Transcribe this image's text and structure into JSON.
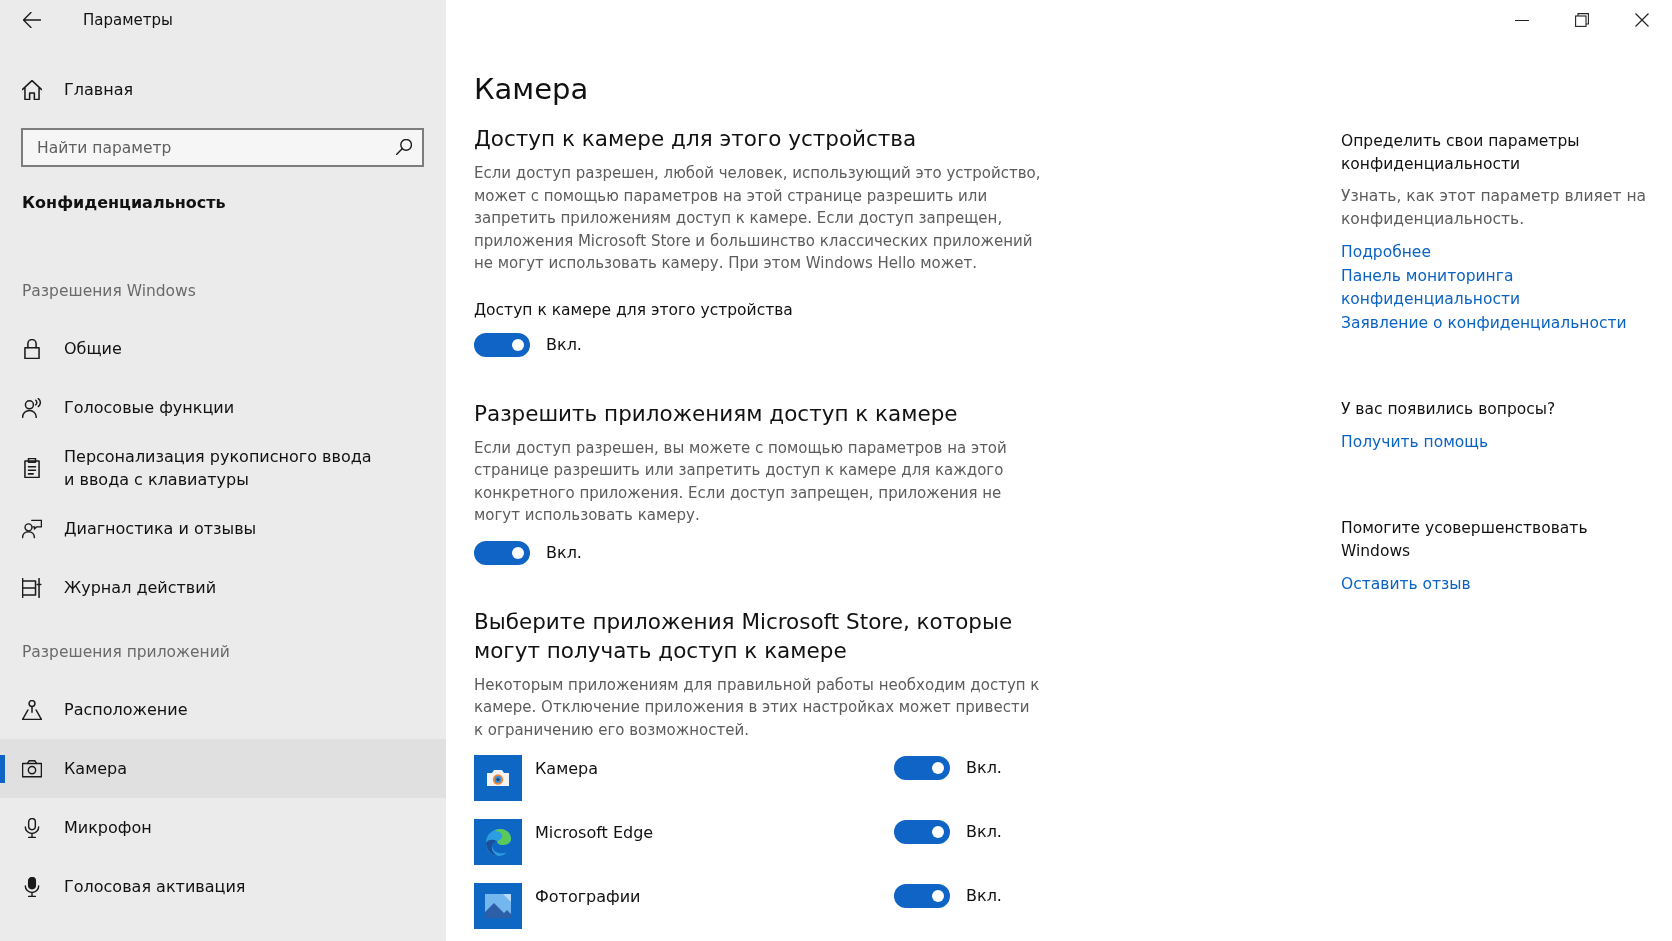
{
  "window": {
    "title": "Параметры"
  },
  "sidebar": {
    "home": {
      "label": "Главная"
    },
    "search": {
      "placeholder": "Найти параметр"
    },
    "category": "Конфиденциальность",
    "groups": [
      {
        "heading": "Разрешения Windows",
        "items": [
          {
            "label": "Общие",
            "selected": false
          },
          {
            "label": "Голосовые функции",
            "selected": false
          },
          {
            "label": "Персонализация рукописного ввода и ввода с клавиатуры",
            "selected": false
          },
          {
            "label": "Диагностика и отзывы",
            "selected": false
          },
          {
            "label": "Журнал действий",
            "selected": false
          }
        ]
      },
      {
        "heading": "Разрешения приложений",
        "items": [
          {
            "label": "Расположение",
            "selected": false
          },
          {
            "label": "Камера",
            "selected": true
          },
          {
            "label": "Микрофон",
            "selected": false
          },
          {
            "label": "Голосовая активация",
            "selected": false
          }
        ]
      }
    ]
  },
  "main": {
    "title": "Камера",
    "sections": [
      {
        "heading": "Доступ к камере для этого устройства",
        "description": "Если доступ разрешен, любой человек, использующий это устройство, может с помощью параметров на этой странице разрешить или запретить приложениям доступ к камере. Если доступ запрещен, приложения Microsoft Store и большинство классических приложений не могут использовать камеру. При этом Windows Hello может.",
        "toggle": {
          "label": "Доступ к камере для этого устройства",
          "on": true,
          "state_label": "Вкл."
        }
      },
      {
        "heading": "Разрешить приложениям доступ к камере",
        "description": "Если доступ разрешен, вы можете с помощью параметров на этой странице разрешить или запретить доступ к камере для каждого конкретного приложения. Если доступ запрещен, приложения не могут использовать камеру.",
        "toggle": {
          "on": true,
          "state_label": "Вкл."
        }
      },
      {
        "heading": "Выберите приложения Microsoft Store, которые могут получать доступ к камере",
        "description": "Некоторым приложениям для правильной работы необходим доступ к камере. Отключение приложения в этих настройках может привести к ограничению его возможностей.",
        "apps": [
          {
            "name": "Камера",
            "on": true,
            "state_label": "Вкл."
          },
          {
            "name": "Microsoft Edge",
            "on": true,
            "state_label": "Вкл."
          },
          {
            "name": "Фотографии",
            "on": true,
            "state_label": "Вкл."
          }
        ]
      }
    ]
  },
  "right_panel": {
    "groups": [
      {
        "heading": "Определить свои параметры конфиденциальности",
        "text": "Узнать, как этот параметр влияет на конфиденциальность.",
        "links": [
          "Подробнее",
          "Панель мониторинга конфиденциальности",
          "Заявление о конфиденциальности"
        ]
      },
      {
        "heading": "У вас появились вопросы?",
        "links": [
          "Получить помощь"
        ]
      },
      {
        "heading": "Помогите усовершенствовать Windows",
        "links": [
          "Оставить отзыв"
        ]
      }
    ]
  }
}
